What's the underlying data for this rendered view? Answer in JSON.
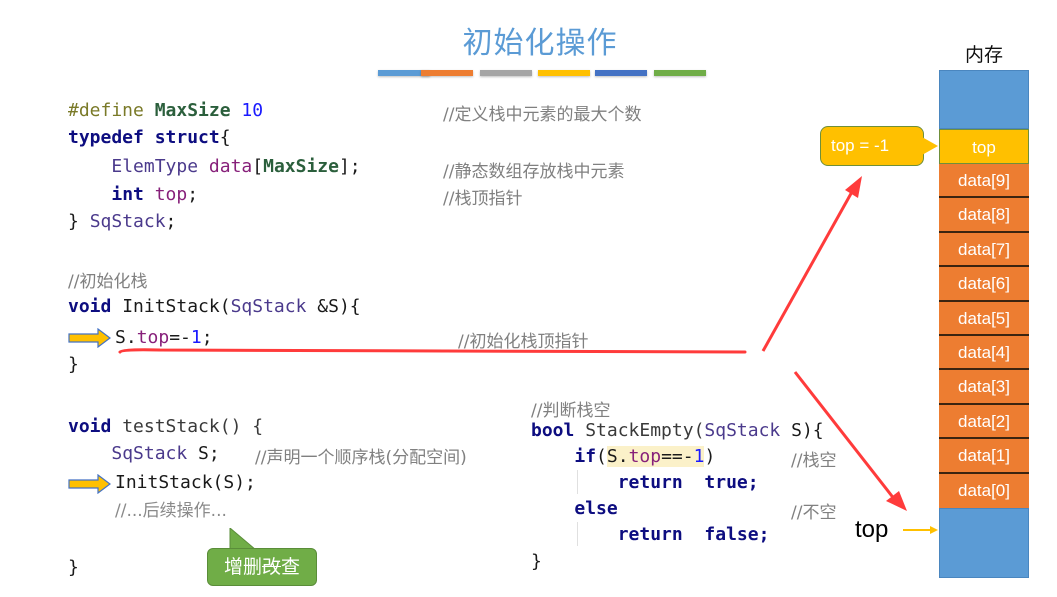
{
  "title": "初始化操作",
  "title_bars": [
    {
      "color": "#5b9bd5"
    },
    {
      "color": "#ed7d31"
    },
    {
      "color": "#a5a5a5"
    },
    {
      "color": "#ffc000"
    },
    {
      "color": "#4472c4"
    },
    {
      "color": "#70ad47"
    }
  ],
  "struct_block": {
    "line1": {
      "pp": "#define",
      "macro": "MaxSize",
      "num": "10",
      "comment": "//定义栈中元素的最大个数"
    },
    "line2": {
      "kw1": "typedef",
      "kw2": "struct",
      "brace": "{"
    },
    "line3": {
      "type": "ElemType",
      "field": "data",
      "open": "[",
      "macro": "MaxSize",
      "close": "];",
      "comment": "//静态数组存放栈中元素"
    },
    "line4": {
      "kw": "int",
      "field": "top",
      "semi": ";",
      "comment": "//栈顶指针"
    },
    "line5": {
      "brace": "}",
      "type": "SqStack",
      "semi": ";"
    }
  },
  "init_block": {
    "comment": "//初始化栈",
    "sig": {
      "kw": "void",
      "name": "InitStack(",
      "type": "SqStack",
      "param": " &S){"
    },
    "body": {
      "var": "S.",
      "field": "top",
      "op": "=-",
      "num": "1",
      "semi": ";",
      "comment": "//初始化栈顶指针"
    },
    "close": "}"
  },
  "test_block": {
    "sig": {
      "kw": "void",
      "name": " testStack() {"
    },
    "decl": {
      "type": "SqStack",
      "rest": " S;",
      "comment": "//声明一个顺序栈(分配空间)"
    },
    "call": "InitStack(S);",
    "comment": "//...后续操作...",
    "close": "}"
  },
  "empty_block": {
    "comment": "//判断栈空",
    "sig": {
      "kw": "bool",
      "name": " StackEmpty(",
      "type": "SqStack",
      "rest": " S){"
    },
    "if_line": {
      "kw": "if",
      "open": "(",
      "var": "S.",
      "field": "top",
      "op": "==-",
      "num": "1",
      "close": ")",
      "comment": "//栈空"
    },
    "ret_true": {
      "kw": "return",
      "val": "true",
      "semi": ";"
    },
    "else_line": {
      "kw": "else",
      "comment": "//不空"
    },
    "ret_false": {
      "kw": "return",
      "val": "false",
      "semi": ";"
    },
    "close": "}"
  },
  "green_callout": {
    "part1": "增删",
    "part2": "改",
    "part3": "查"
  },
  "memory": {
    "label": "内存",
    "top_cell": "top",
    "data_cells": [
      "data[9]",
      "data[8]",
      "data[7]",
      "data[6]",
      "data[5]",
      "data[4]",
      "data[3]",
      "data[2]",
      "data[1]",
      "data[0]"
    ]
  },
  "callout_top": "top = -1",
  "top_pointer_label": "top",
  "colors": {
    "memory_blue": "#5b9bd5",
    "memory_top": "#ffc000",
    "memory_data": "#ed7d31",
    "annotation_red": "#ff3333",
    "callout_green": "#70ad47"
  }
}
